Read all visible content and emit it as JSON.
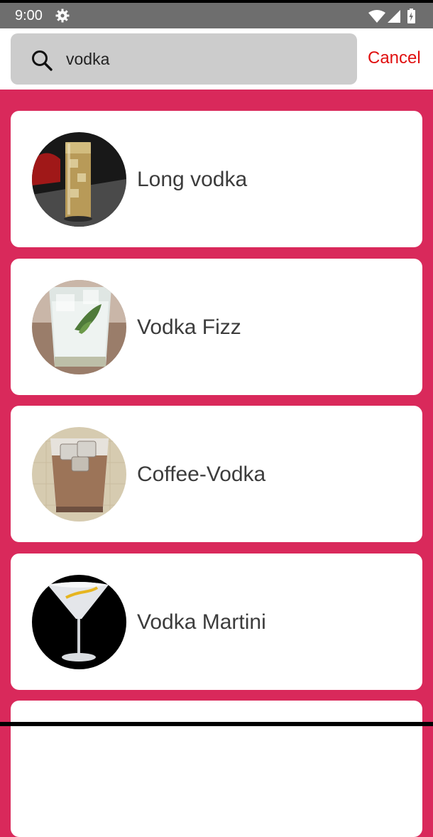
{
  "status_bar": {
    "time": "9:00",
    "icons": [
      "gear-icon",
      "wifi-icon",
      "signal-icon",
      "battery-icon"
    ]
  },
  "search": {
    "icon": "search-icon",
    "value": "vodka",
    "cancel_label": "Cancel"
  },
  "colors": {
    "background": "#d9295b",
    "cancel": "#e01010",
    "search_box": "#cccccc"
  },
  "results": [
    {
      "name": "Long vodka",
      "image": "long-vodka-glass-photo"
    },
    {
      "name": "Vodka Fizz",
      "image": "vodka-fizz-glass-photo"
    },
    {
      "name": "Coffee-Vodka",
      "image": "coffee-vodka-glass-photo"
    },
    {
      "name": "Vodka Martini",
      "image": "vodka-martini-glass-photo"
    }
  ]
}
